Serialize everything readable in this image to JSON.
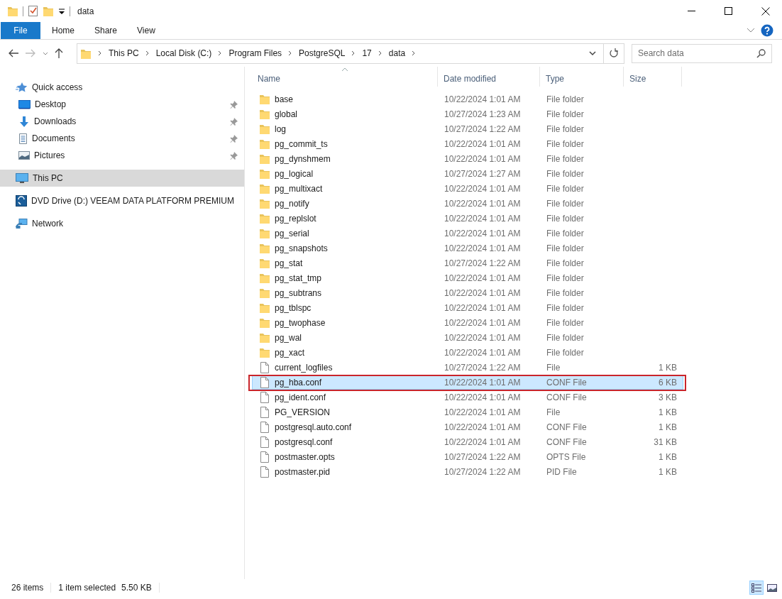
{
  "title_bar": {
    "title": "data"
  },
  "ribbon": {
    "tabs": [
      {
        "label": "File",
        "kind": "file-menu"
      },
      {
        "label": "Home",
        "kind": "tab"
      },
      {
        "label": "Share",
        "kind": "tab"
      },
      {
        "label": "View",
        "kind": "tab"
      }
    ]
  },
  "address_bar": {
    "path": [
      "This PC",
      "Local Disk (C:)",
      "Program Files",
      "PostgreSQL",
      "17",
      "data"
    ]
  },
  "search": {
    "placeholder": "Search data"
  },
  "sidebar": {
    "items": [
      {
        "label": "Quick access",
        "kind": "quick-access",
        "selected": false,
        "children": [
          {
            "label": "Desktop",
            "kind": "desktop",
            "pinned": true
          },
          {
            "label": "Downloads",
            "kind": "downloads",
            "pinned": true
          },
          {
            "label": "Documents",
            "kind": "documents",
            "pinned": true
          },
          {
            "label": "Pictures",
            "kind": "pictures",
            "pinned": true
          }
        ]
      },
      {
        "label": "This PC",
        "kind": "pc",
        "selected": true
      },
      {
        "label": "DVD Drive (D:) VEEAM DATA PLATFORM PREMIUM",
        "kind": "dvd",
        "selected": false
      },
      {
        "label": "Network",
        "kind": "network",
        "selected": false
      }
    ]
  },
  "file_list": {
    "columns": [
      {
        "label": "Name",
        "sorted": true
      },
      {
        "label": "Date modified",
        "sorted": false
      },
      {
        "label": "Type",
        "sorted": false
      },
      {
        "label": "Size",
        "sorted": false
      }
    ],
    "rows": [
      {
        "name": "base",
        "date": "10/22/2024 1:01 AM",
        "type": "File folder",
        "kind": "folder",
        "selected": false,
        "highlighted": false
      },
      {
        "name": "global",
        "date": "10/27/2024 1:23 AM",
        "type": "File folder",
        "kind": "folder",
        "selected": false,
        "highlighted": false
      },
      {
        "name": "log",
        "date": "10/27/2024 1:22 AM",
        "type": "File folder",
        "kind": "folder",
        "selected": false,
        "highlighted": false
      },
      {
        "name": "pg_commit_ts",
        "date": "10/22/2024 1:01 AM",
        "type": "File folder",
        "kind": "folder",
        "selected": false,
        "highlighted": false
      },
      {
        "name": "pg_dynshmem",
        "date": "10/22/2024 1:01 AM",
        "type": "File folder",
        "kind": "folder",
        "selected": false,
        "highlighted": false
      },
      {
        "name": "pg_logical",
        "date": "10/27/2024 1:27 AM",
        "type": "File folder",
        "kind": "folder",
        "selected": false,
        "highlighted": false
      },
      {
        "name": "pg_multixact",
        "date": "10/22/2024 1:01 AM",
        "type": "File folder",
        "kind": "folder",
        "selected": false,
        "highlighted": false
      },
      {
        "name": "pg_notify",
        "date": "10/22/2024 1:01 AM",
        "type": "File folder",
        "kind": "folder",
        "selected": false,
        "highlighted": false
      },
      {
        "name": "pg_replslot",
        "date": "10/22/2024 1:01 AM",
        "type": "File folder",
        "kind": "folder",
        "selected": false,
        "highlighted": false
      },
      {
        "name": "pg_serial",
        "date": "10/22/2024 1:01 AM",
        "type": "File folder",
        "kind": "folder",
        "selected": false,
        "highlighted": false
      },
      {
        "name": "pg_snapshots",
        "date": "10/22/2024 1:01 AM",
        "type": "File folder",
        "kind": "folder",
        "selected": false,
        "highlighted": false
      },
      {
        "name": "pg_stat",
        "date": "10/27/2024 1:22 AM",
        "type": "File folder",
        "kind": "folder",
        "selected": false,
        "highlighted": false
      },
      {
        "name": "pg_stat_tmp",
        "date": "10/22/2024 1:01 AM",
        "type": "File folder",
        "kind": "folder",
        "selected": false,
        "highlighted": false
      },
      {
        "name": "pg_subtrans",
        "date": "10/22/2024 1:01 AM",
        "type": "File folder",
        "kind": "folder",
        "selected": false,
        "highlighted": false
      },
      {
        "name": "pg_tblspc",
        "date": "10/22/2024 1:01 AM",
        "type": "File folder",
        "kind": "folder",
        "selected": false,
        "highlighted": false
      },
      {
        "name": "pg_twophase",
        "date": "10/22/2024 1:01 AM",
        "type": "File folder",
        "kind": "folder",
        "selected": false,
        "highlighted": false
      },
      {
        "name": "pg_wal",
        "date": "10/22/2024 1:01 AM",
        "type": "File folder",
        "kind": "folder",
        "selected": false,
        "highlighted": false
      },
      {
        "name": "pg_xact",
        "date": "10/22/2024 1:01 AM",
        "type": "File folder",
        "kind": "folder",
        "selected": false,
        "highlighted": false
      },
      {
        "name": "current_logfiles",
        "date": "10/27/2024 1:22 AM",
        "type": "File",
        "size": "1 KB",
        "kind": "file",
        "selected": false,
        "highlighted": false
      },
      {
        "name": "pg_hba.conf",
        "date": "10/22/2024 1:01 AM",
        "type": "CONF File",
        "size": "6 KB",
        "kind": "file",
        "selected": true,
        "highlighted": true
      },
      {
        "name": "pg_ident.conf",
        "date": "10/22/2024 1:01 AM",
        "type": "CONF File",
        "size": "3 KB",
        "kind": "file",
        "selected": false,
        "highlighted": false
      },
      {
        "name": "PG_VERSION",
        "date": "10/22/2024 1:01 AM",
        "type": "File",
        "size": "1 KB",
        "kind": "file",
        "selected": false,
        "highlighted": false
      },
      {
        "name": "postgresql.auto.conf",
        "date": "10/22/2024 1:01 AM",
        "type": "CONF File",
        "size": "1 KB",
        "kind": "file",
        "selected": false,
        "highlighted": false
      },
      {
        "name": "postgresql.conf",
        "date": "10/22/2024 1:01 AM",
        "type": "CONF File",
        "size": "31 KB",
        "kind": "file",
        "selected": false,
        "highlighted": false
      },
      {
        "name": "postmaster.opts",
        "date": "10/27/2024 1:22 AM",
        "type": "OPTS File",
        "size": "1 KB",
        "kind": "file",
        "selected": false,
        "highlighted": false
      },
      {
        "name": "postmaster.pid",
        "date": "10/27/2024 1:22 AM",
        "type": "PID File",
        "size": "1 KB",
        "kind": "file",
        "selected": false,
        "highlighted": false
      }
    ]
  },
  "status_bar": {
    "item_count": "26 items",
    "selection": "1 item selected",
    "selection_size": "5.50 KB",
    "views": [
      {
        "kind": "details",
        "selected": true
      },
      {
        "kind": "large-icons",
        "selected": false
      }
    ]
  }
}
